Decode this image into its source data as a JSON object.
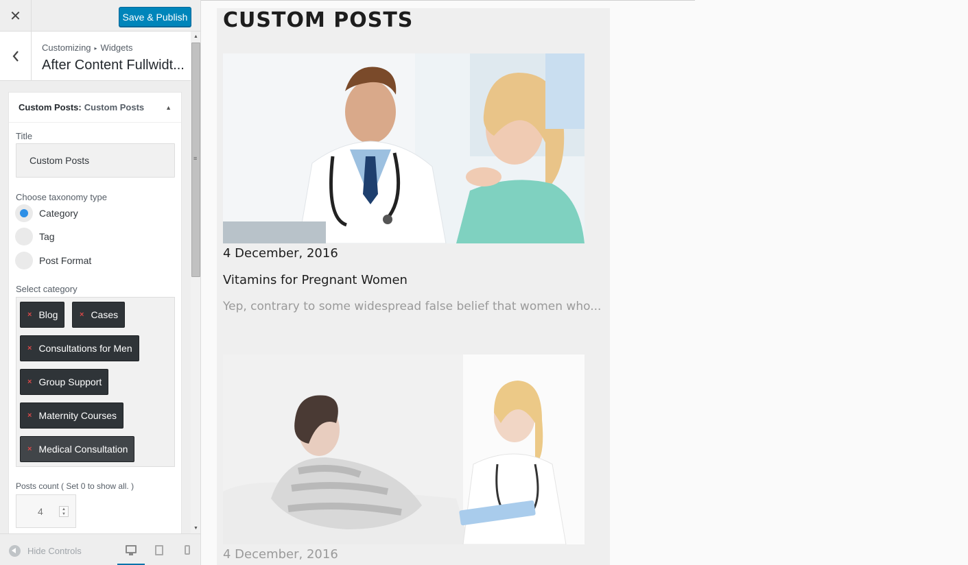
{
  "header": {
    "close_label": "✕",
    "save_label": "Save & Publish"
  },
  "panel": {
    "breadcrumb_root": "Customizing",
    "breadcrumb_separator": "▸",
    "breadcrumb_section": "Widgets",
    "title": "After Content Fullwidt..."
  },
  "widget": {
    "name": "Custom Posts:",
    "instance": "Custom Posts",
    "fields": {
      "title_label": "Title",
      "title_value": "Custom Posts",
      "taxonomy_label": "Choose taxonomy type",
      "taxonomy_options": [
        {
          "label": "Category",
          "checked": true
        },
        {
          "label": "Tag",
          "checked": false
        },
        {
          "label": "Post Format",
          "checked": false
        }
      ],
      "category_label": "Select category",
      "selected_categories": [
        "Blog",
        "Cases",
        "Consultations for Men",
        "Group Support",
        "Maternity Courses",
        "Medical Consultation"
      ],
      "remove_symbol": "×",
      "posts_count_label": "Posts count ( Set 0 to show all. )",
      "posts_count_value": "4"
    }
  },
  "footer": {
    "hide_controls_label": "Hide Controls",
    "devices": [
      "desktop-icon",
      "tablet-icon",
      "mobile-icon"
    ],
    "active_device": "desktop"
  },
  "preview": {
    "section_title": "CUSTOM POSTS",
    "posts": [
      {
        "date": "4 December, 2016",
        "title": "Vitamins for Pregnant Women",
        "excerpt": "Yep, contrary to some widespread false belief that women who..."
      },
      {
        "date": "4 December, 2016"
      }
    ]
  },
  "colors": {
    "accent": "#0085ba",
    "radio_checked": "#2d8fe6",
    "chip_bg": "#2f3438",
    "chip_remove": "#d94848"
  }
}
